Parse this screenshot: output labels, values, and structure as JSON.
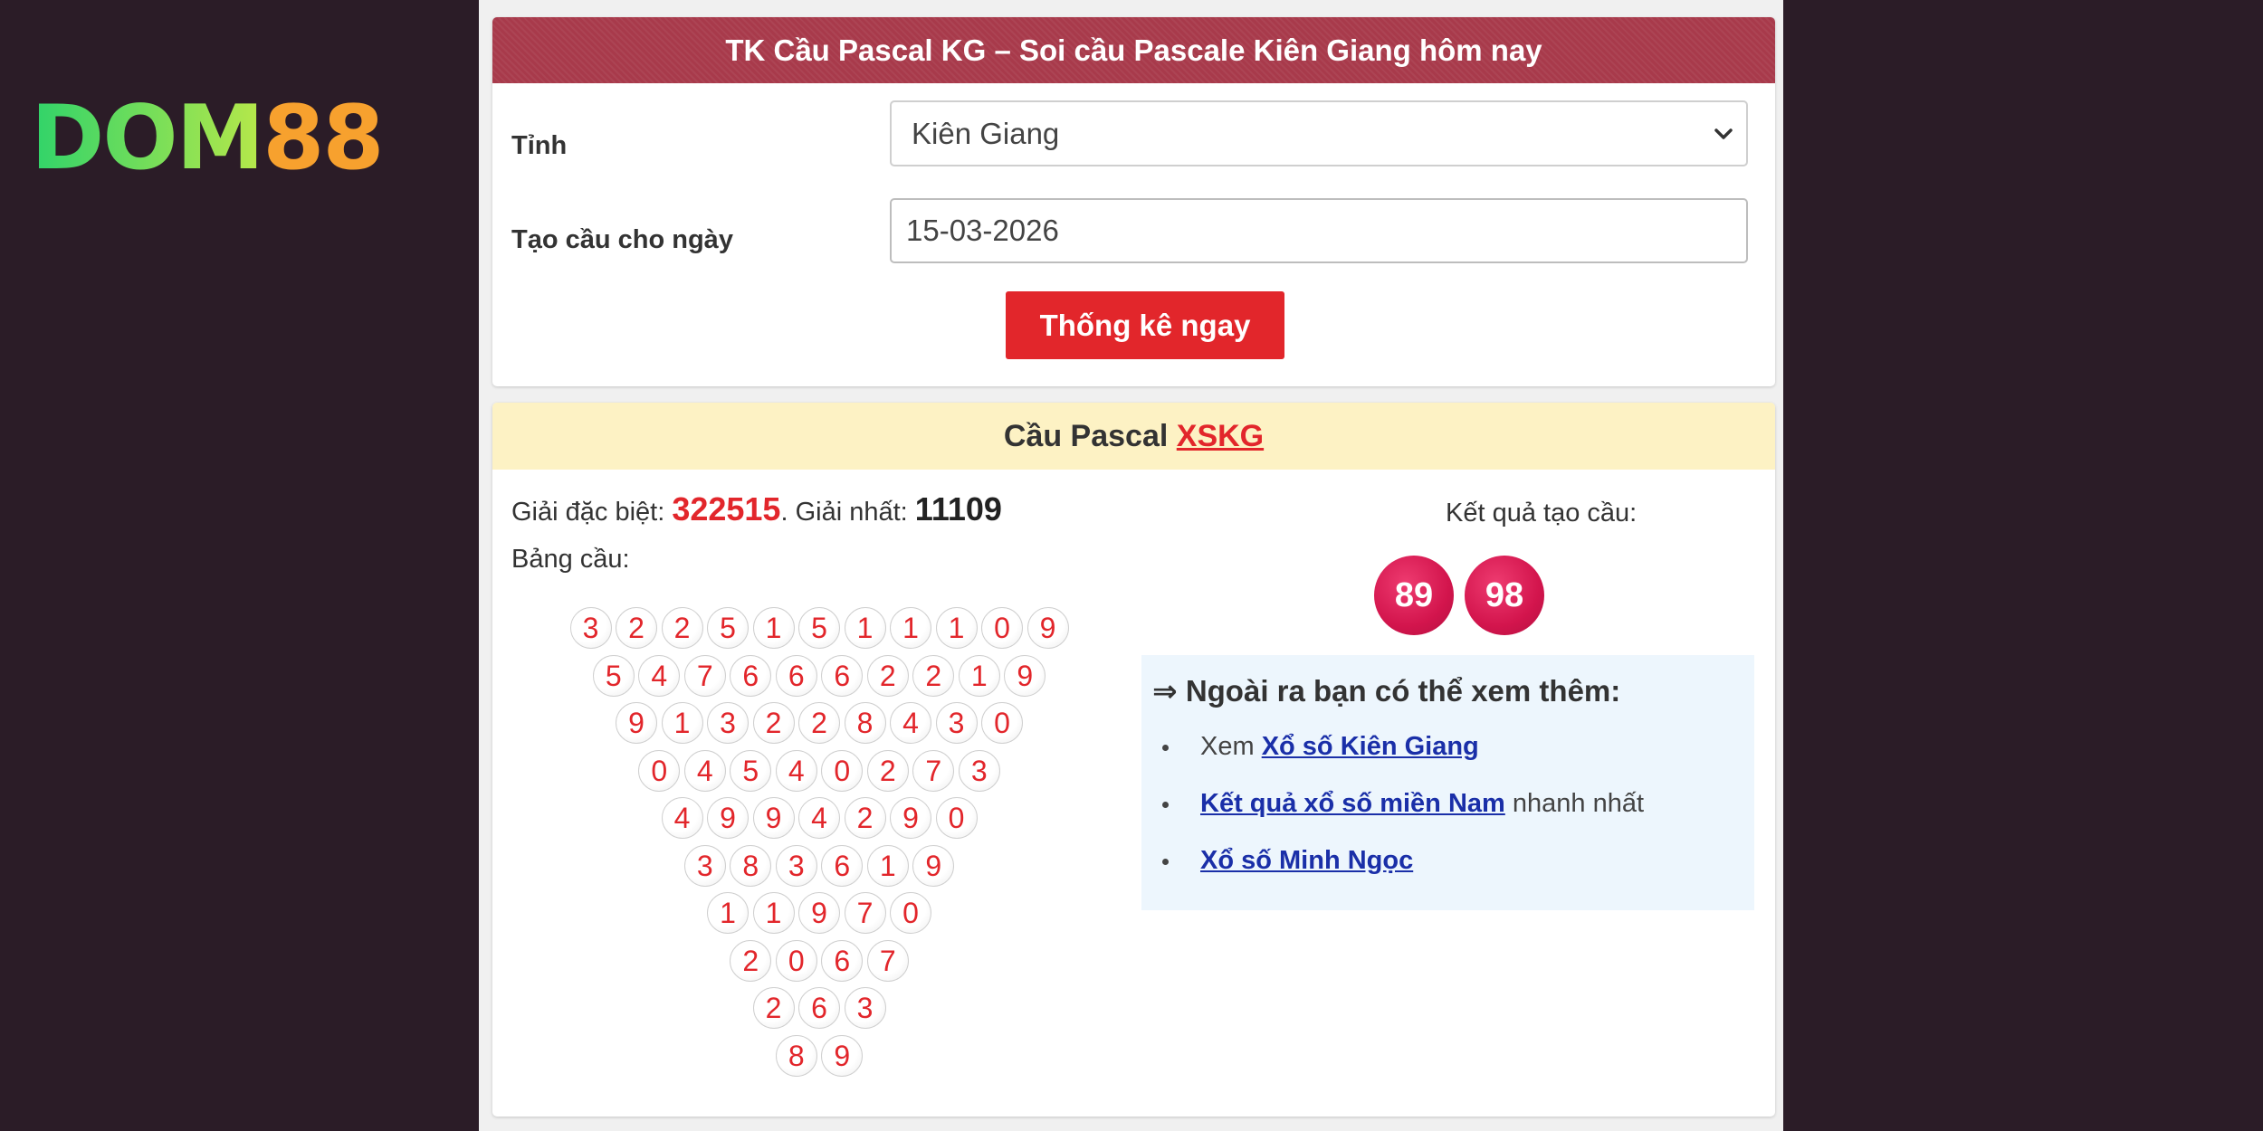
{
  "logo": {
    "part1": "DOM",
    "part2": "88"
  },
  "form": {
    "title": "TK Cầu Pascal KG – Soi cầu Pascale Kiên Giang hôm nay",
    "province_label": "Tỉnh",
    "province_value": "Kiên Giang",
    "date_label": "Tạo cầu cho ngày",
    "date_value": "15-03-2026",
    "submit_label": "Thống kê ngay"
  },
  "result": {
    "header_prefix": "Cầu Pascal ",
    "header_link": "XSKG",
    "special_label": "Giải đặc biệt: ",
    "special_value": "322515",
    "first_sep": ". Giải nhất: ",
    "first_value": "11109",
    "table_label": "Bảng cầu:",
    "pyramid": [
      [
        3,
        2,
        2,
        5,
        1,
        5,
        1,
        1,
        1,
        0,
        9
      ],
      [
        5,
        4,
        7,
        6,
        6,
        6,
        2,
        2,
        1,
        9
      ],
      [
        9,
        1,
        3,
        2,
        2,
        8,
        4,
        3,
        0
      ],
      [
        0,
        4,
        5,
        4,
        0,
        2,
        7,
        3
      ],
      [
        4,
        9,
        9,
        4,
        2,
        9,
        0
      ],
      [
        3,
        8,
        3,
        6,
        1,
        9
      ],
      [
        1,
        1,
        9,
        7,
        0
      ],
      [
        2,
        0,
        6,
        7
      ],
      [
        2,
        6,
        3
      ],
      [
        8,
        9
      ]
    ],
    "outcome_label": "Kết quả tạo cầu:",
    "outcome_numbers": [
      "89",
      "98"
    ]
  },
  "more": {
    "title": "⇒ Ngoài ra bạn có thể xem thêm:",
    "item1_prefix": "Xem ",
    "item1_link": "Xổ số Kiên Giang",
    "item2_link": "Kết quả xổ số miền Nam",
    "item2_suffix": " nhanh nhất",
    "item3_link": "Xổ số Minh Ngọc"
  },
  "colors": {
    "accent": "#e2262b",
    "header_bg": "#a83a4b",
    "result_header_bg": "#fdf2c4",
    "ball_pink": "#d3154d"
  }
}
